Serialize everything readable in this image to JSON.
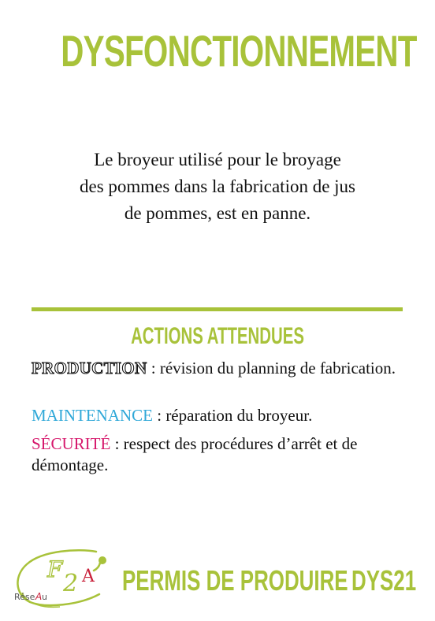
{
  "card": {
    "title": "DYSFONCTIONNEMENT",
    "description_lines": [
      "Le broyeur utilisé pour le broyage",
      "des pommes dans la fabrication de jus",
      "de pommes, est en panne."
    ],
    "actions_heading": "ACTIONS ATTENDUES",
    "actions": {
      "production": {
        "label": "PRODUCTION",
        "text": " : révision du planning de fabrication."
      },
      "maintenance": {
        "label": "MAINTENANCE",
        "text": " : réparation du broyeur."
      },
      "securite": {
        "label": "SÉCURITÉ",
        "text": " : respect des procédures d’arrêt et de démontage."
      }
    }
  },
  "footer": {
    "logo": {
      "icon": "f2a-reseau-logo",
      "text": "RéseAu F2A"
    },
    "title": "PERMIS DE PRODUIRE",
    "code": "DYS21"
  },
  "colors": {
    "accent_green": "#a8c23a",
    "maintenance_blue": "#2fa8d8",
    "securite_pink": "#d6186c",
    "logo_red": "#c8203a"
  }
}
